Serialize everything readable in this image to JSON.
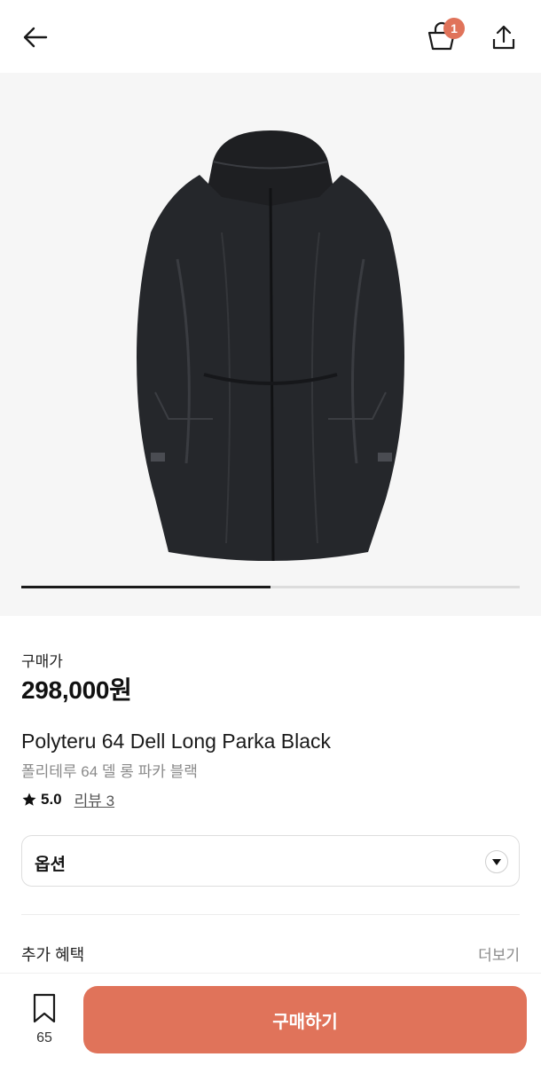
{
  "header": {
    "cart_count": "1"
  },
  "gallery": {
    "image_count": 2,
    "current_index": 1
  },
  "product": {
    "price_label": "구매가",
    "price": "298,000원",
    "title_en": "Polyteru 64 Dell Long Parka Black",
    "title_ko": "폴리테루 64 델 롱 파카 블랙",
    "rating": "5.0",
    "review_link": "리뷰 3"
  },
  "option": {
    "label": "옵션"
  },
  "benefits": {
    "label": "추가 혜택",
    "more": "더보기"
  },
  "bottom": {
    "bookmark_count": "65",
    "buy_label": "구매하기"
  },
  "colors": {
    "accent": "#e0735a",
    "text": "#111111",
    "muted": "#8a8a8a"
  },
  "icons": [
    "back-arrow-icon",
    "shopping-bag-icon",
    "share-icon",
    "star-icon",
    "chevron-down-icon",
    "bookmark-icon"
  ]
}
